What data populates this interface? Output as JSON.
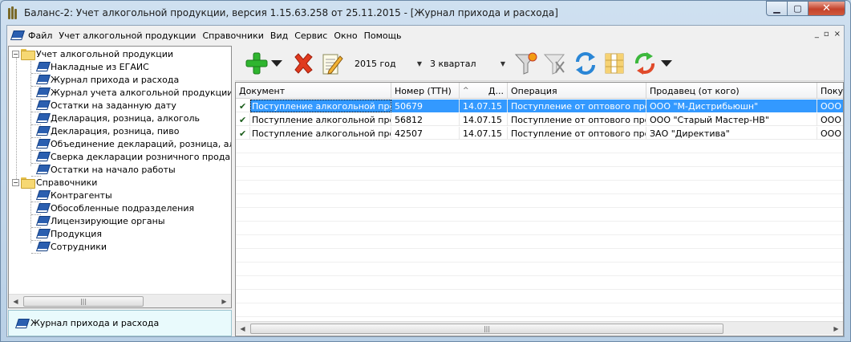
{
  "window": {
    "title": "Баланс-2: Учет алкогольной продукции, версия 1.15.63.258 от 25.11.2015 - [Журнал прихода и расхода]",
    "min": "▁",
    "max": "▢",
    "close": "✕"
  },
  "menu": {
    "items": [
      "Файл",
      "Учет алкогольной продукции",
      "Справочники",
      "Вид",
      "Сервис",
      "Окно",
      "Помощь"
    ],
    "mdi": [
      "_",
      "▫",
      "×"
    ]
  },
  "tree": {
    "groups": [
      {
        "label": "Учет алкогольной продукции",
        "expander": "−",
        "items": [
          "Накладные из ЕГАИС",
          "Журнал прихода и расхода",
          "Журнал учета алкогольной продукции",
          "Остатки на заданную дату",
          "Декларация, розница, алкоголь",
          "Декларация, розница, пиво",
          "Объединение деклараций, розница, алкоголь",
          "Сверка декларации розничного продавца",
          "Остатки на начало работы"
        ]
      },
      {
        "label": "Справочники",
        "expander": "−",
        "items": [
          "Контрагенты",
          "Обособленные подразделения",
          "Лицензирующие органы",
          "Продукция",
          "Сотрудники"
        ]
      }
    ]
  },
  "status": {
    "current_journal": "Журнал прихода и расхода"
  },
  "toolbar": {
    "year": "2015 год",
    "quarter": "3 квартал",
    "icons": [
      "add-icon",
      "dropdown-arrow-icon",
      "delete-icon",
      "edit-icon",
      "filter-icon",
      "clear-filter-icon",
      "refresh-icon",
      "columns-icon",
      "sync-icon",
      "dropdown-arrow-icon"
    ]
  },
  "grid": {
    "columns": [
      "Документ",
      "Номер (ТТН)",
      "Д...",
      "Операция",
      "Продавец (от кого)",
      "Поку"
    ],
    "sort_mark": "^",
    "rows": [
      {
        "check": "✔",
        "document": "Поступление алкогольной прод...",
        "number": "50679",
        "date": "14.07.15",
        "operation": "Поступление от оптового про...",
        "seller": "ООО \"М-Дистрибьюшн\"",
        "buyer": "ООО"
      },
      {
        "check": "✔",
        "document": "Поступление алкогольной прод...",
        "number": "56812",
        "date": "14.07.15",
        "operation": "Поступление от оптового про...",
        "seller": "ООО \"Старый Мастер-НВ\"",
        "buyer": "ООО"
      },
      {
        "check": "✔",
        "document": "Поступление алкогольной прод...",
        "number": "42507",
        "date": "14.07.15",
        "operation": "Поступление от оптового про...",
        "seller": "ЗАО \"Директива\"",
        "buyer": "ООО"
      }
    ]
  },
  "colors": {
    "selection": "#3399ff",
    "add": "#2fb52f",
    "delete": "#e03a1e"
  }
}
